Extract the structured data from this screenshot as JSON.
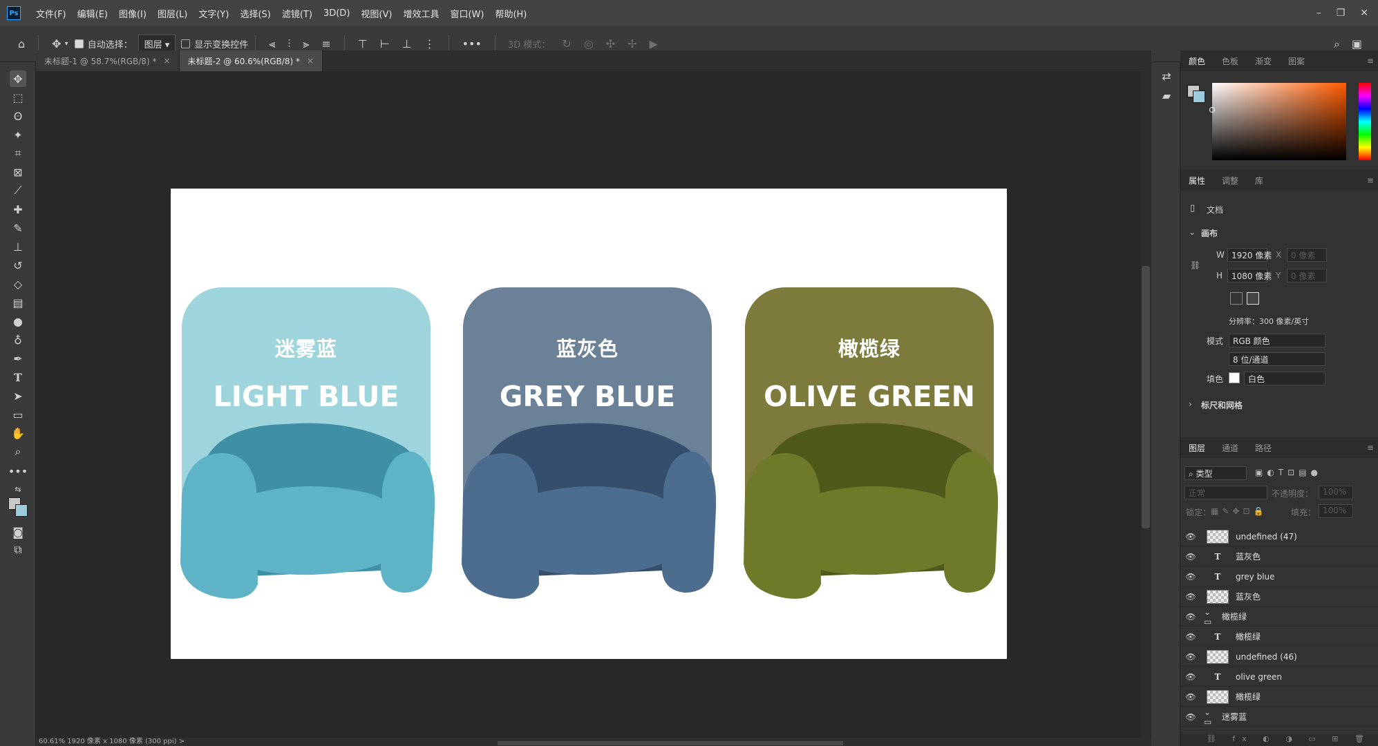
{
  "menubar": {
    "logo": "Ps",
    "items": [
      "文件(F)",
      "编辑(E)",
      "图像(I)",
      "图层(L)",
      "文字(Y)",
      "选择(S)",
      "滤镜(T)",
      "3D(D)",
      "视图(V)",
      "增效工具",
      "窗口(W)",
      "帮助(H)"
    ],
    "minimize": "–",
    "restore": "❐",
    "close": "✕"
  },
  "options": {
    "auto_select_label": "自动选择：",
    "auto_select_value": "图层",
    "show_transform_label": "显示变换控件",
    "more": "•••",
    "mode3d_label": "3D 模式："
  },
  "tabs": [
    {
      "title": "未标题-1 @ 58.7%(RGB/8) *",
      "close": "×"
    },
    {
      "title": "未标题-2 @ 60.6%(RGB/8) *",
      "close": "×"
    }
  ],
  "canvas": {
    "cards": [
      {
        "cn": "迷雾蓝",
        "en": "LIGHT BLUE",
        "bg": "#9ed4dc",
        "chair": "#5fb3c6",
        "chair_dark": "#3f8fa5"
      },
      {
        "cn": "蓝灰色",
        "en": "GREY BLUE",
        "bg": "#6b8198",
        "chair": "#4d6d8e",
        "chair_dark": "#344e6b"
      },
      {
        "cn": "橄榄绿",
        "en": "OLIVE GREEN",
        "bg": "#7d7b3b",
        "chair": "#6e7a2a",
        "chair_dark": "#4f5a1a"
      }
    ]
  },
  "statusbar": {
    "text": "60.61%   1920 像素 x 1080 像素 (300 ppi)   >"
  },
  "color_panel": {
    "tabs": [
      "颜色",
      "色板",
      "渐变",
      "图案"
    ]
  },
  "properties_panel": {
    "tabs": [
      "属性",
      "调整",
      "库"
    ],
    "doc_label": "文档",
    "canvas_section": "画布",
    "w_label": "W",
    "w_value": "1920 像素",
    "h_label": "H",
    "h_value": "1080 像素",
    "x_label": "X",
    "x_value": "0 像素",
    "y_label": "Y",
    "y_value": "0 像素",
    "resolution": "分辨率：300 像素/英寸",
    "mode_label": "模式",
    "mode_value": "RGB 颜色",
    "depth_value": "8 位/通道",
    "fill_label": "填色",
    "fill_value": "白色",
    "rulers_section": "标尺和网格"
  },
  "layers_panel": {
    "tabs": [
      "图层",
      "通道",
      "路径"
    ],
    "filter_value": "类型",
    "blend_value": "正常",
    "opacity_label": "不透明度：",
    "opacity_value": "100%",
    "lock_label": "锁定：",
    "fill_label": "填充：",
    "fill_value": "100%",
    "layers": [
      {
        "name": "undefined (47)",
        "kind": "image",
        "indent": 1
      },
      {
        "name": "蓝灰色",
        "kind": "text",
        "indent": 1
      },
      {
        "name": "grey blue",
        "kind": "text",
        "indent": 1
      },
      {
        "name": "蓝灰色",
        "kind": "shape",
        "indent": 1
      },
      {
        "name": "橄榄绿",
        "kind": "group",
        "indent": 0
      },
      {
        "name": "橄榄绿",
        "kind": "text",
        "indent": 1
      },
      {
        "name": "undefined (46)",
        "kind": "image",
        "indent": 1
      },
      {
        "name": "olive green",
        "kind": "text",
        "indent": 1
      },
      {
        "name": "橄榄绿",
        "kind": "shape",
        "indent": 1
      },
      {
        "name": "迷雾蓝",
        "kind": "group",
        "indent": 0
      }
    ]
  }
}
